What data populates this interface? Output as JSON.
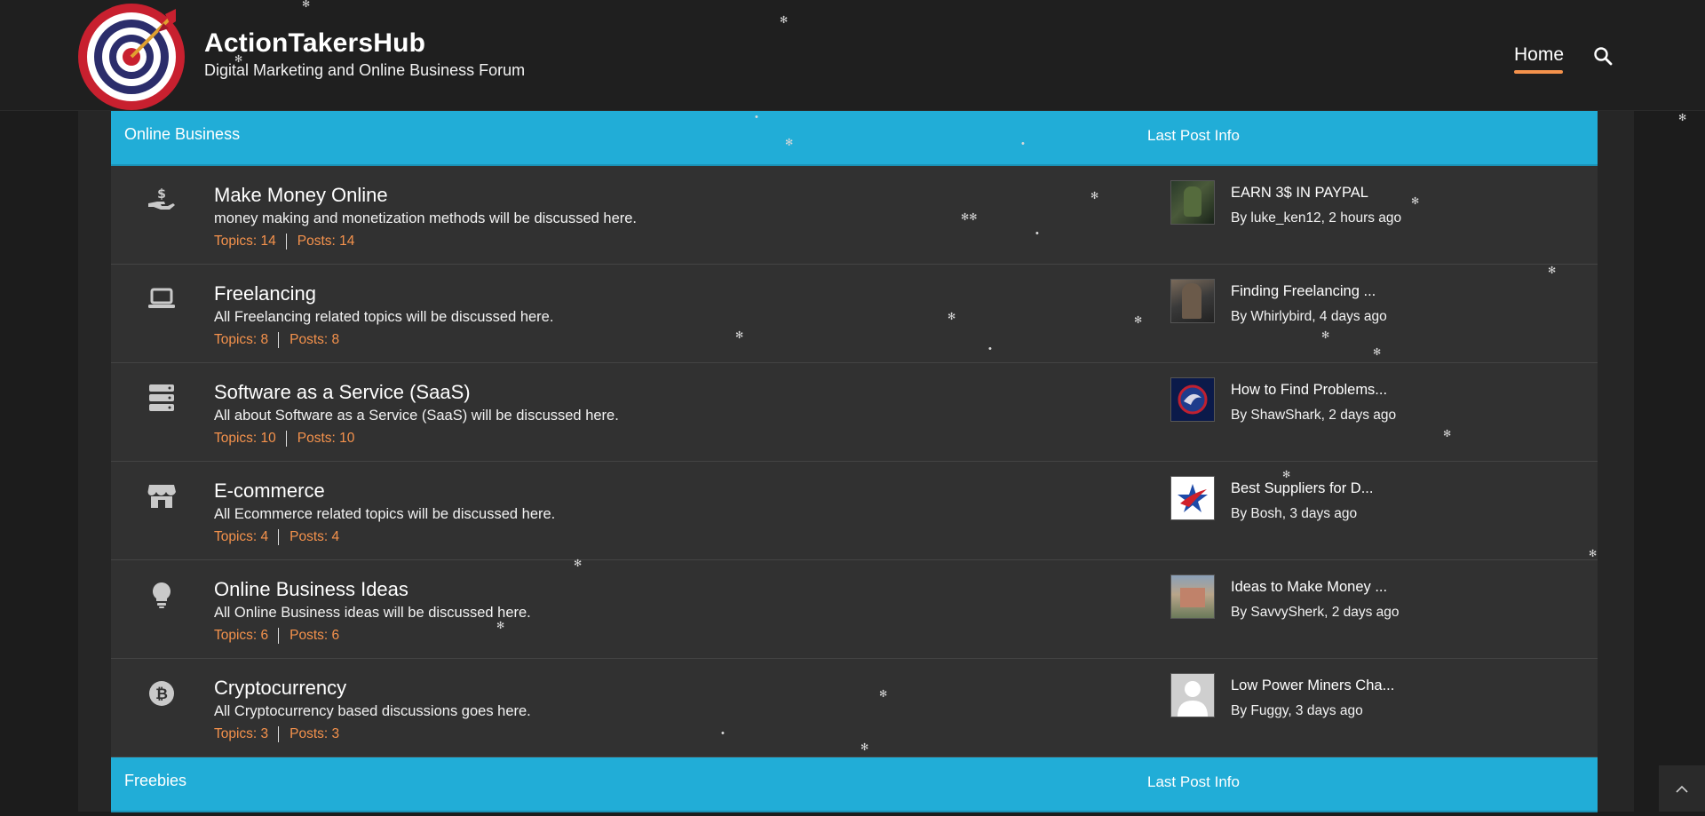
{
  "site": {
    "title": "ActionTakersHub",
    "subtitle": "Digital Marketing and Online Business Forum"
  },
  "nav": {
    "home_label": "Home",
    "search_icon": "search-icon"
  },
  "categories": [
    {
      "title": "Online Business",
      "last_post_header": "Last Post Info",
      "forums": [
        {
          "icon": "money-hand-icon",
          "title": "Make Money Online",
          "description": "money making and monetization methods will be discussed here.",
          "topics": "Topics: 14",
          "posts": "Posts: 14",
          "last_title": "EARN 3$ IN PAYPAL",
          "last_by": "By luke_ken12, 2 hours ago"
        },
        {
          "icon": "laptop-icon",
          "title": "Freelancing",
          "description": "All Freelancing related topics will be discussed here.",
          "topics": "Topics: 8",
          "posts": "Posts: 8",
          "last_title": "Finding Freelancing ...",
          "last_by": "By Whirlybird, 4 days ago"
        },
        {
          "icon": "server-icon",
          "title": "Software as a Service (SaaS)",
          "description": "All about Software as a Service (SaaS) will be discussed here.",
          "topics": "Topics: 10",
          "posts": "Posts: 10",
          "last_title": "How to Find Problems...",
          "last_by": "By ShawShark, 2 days ago"
        },
        {
          "icon": "store-icon",
          "title": "E-commerce",
          "description": "All Ecommerce related topics will be discussed here.",
          "topics": "Topics: 4",
          "posts": "Posts: 4",
          "last_title": "Best Suppliers for D...",
          "last_by": "By Bosh, 3 days ago"
        },
        {
          "icon": "lightbulb-icon",
          "title": "Online Business Ideas",
          "description": "All Online Business ideas will be discussed here.",
          "topics": "Topics: 6",
          "posts": "Posts: 6",
          "last_title": "Ideas to Make Money ...",
          "last_by": "By SavvySherk, 2 days ago"
        },
        {
          "icon": "bitcoin-icon",
          "title": "Cryptocurrency",
          "description": "All Cryptocurrency based discussions goes here.",
          "topics": "Topics: 3",
          "posts": "Posts: 3",
          "last_title": "Low Power Miners Cha...",
          "last_by": "By Fuggy, 3 days ago"
        }
      ]
    },
    {
      "title": "Freebies",
      "last_post_header": "Last Post Info"
    }
  ],
  "colors": {
    "accent": "#f5924c",
    "category_header": "#21add7",
    "row_bg": "#313131",
    "header_bg": "#1f1f1f"
  }
}
